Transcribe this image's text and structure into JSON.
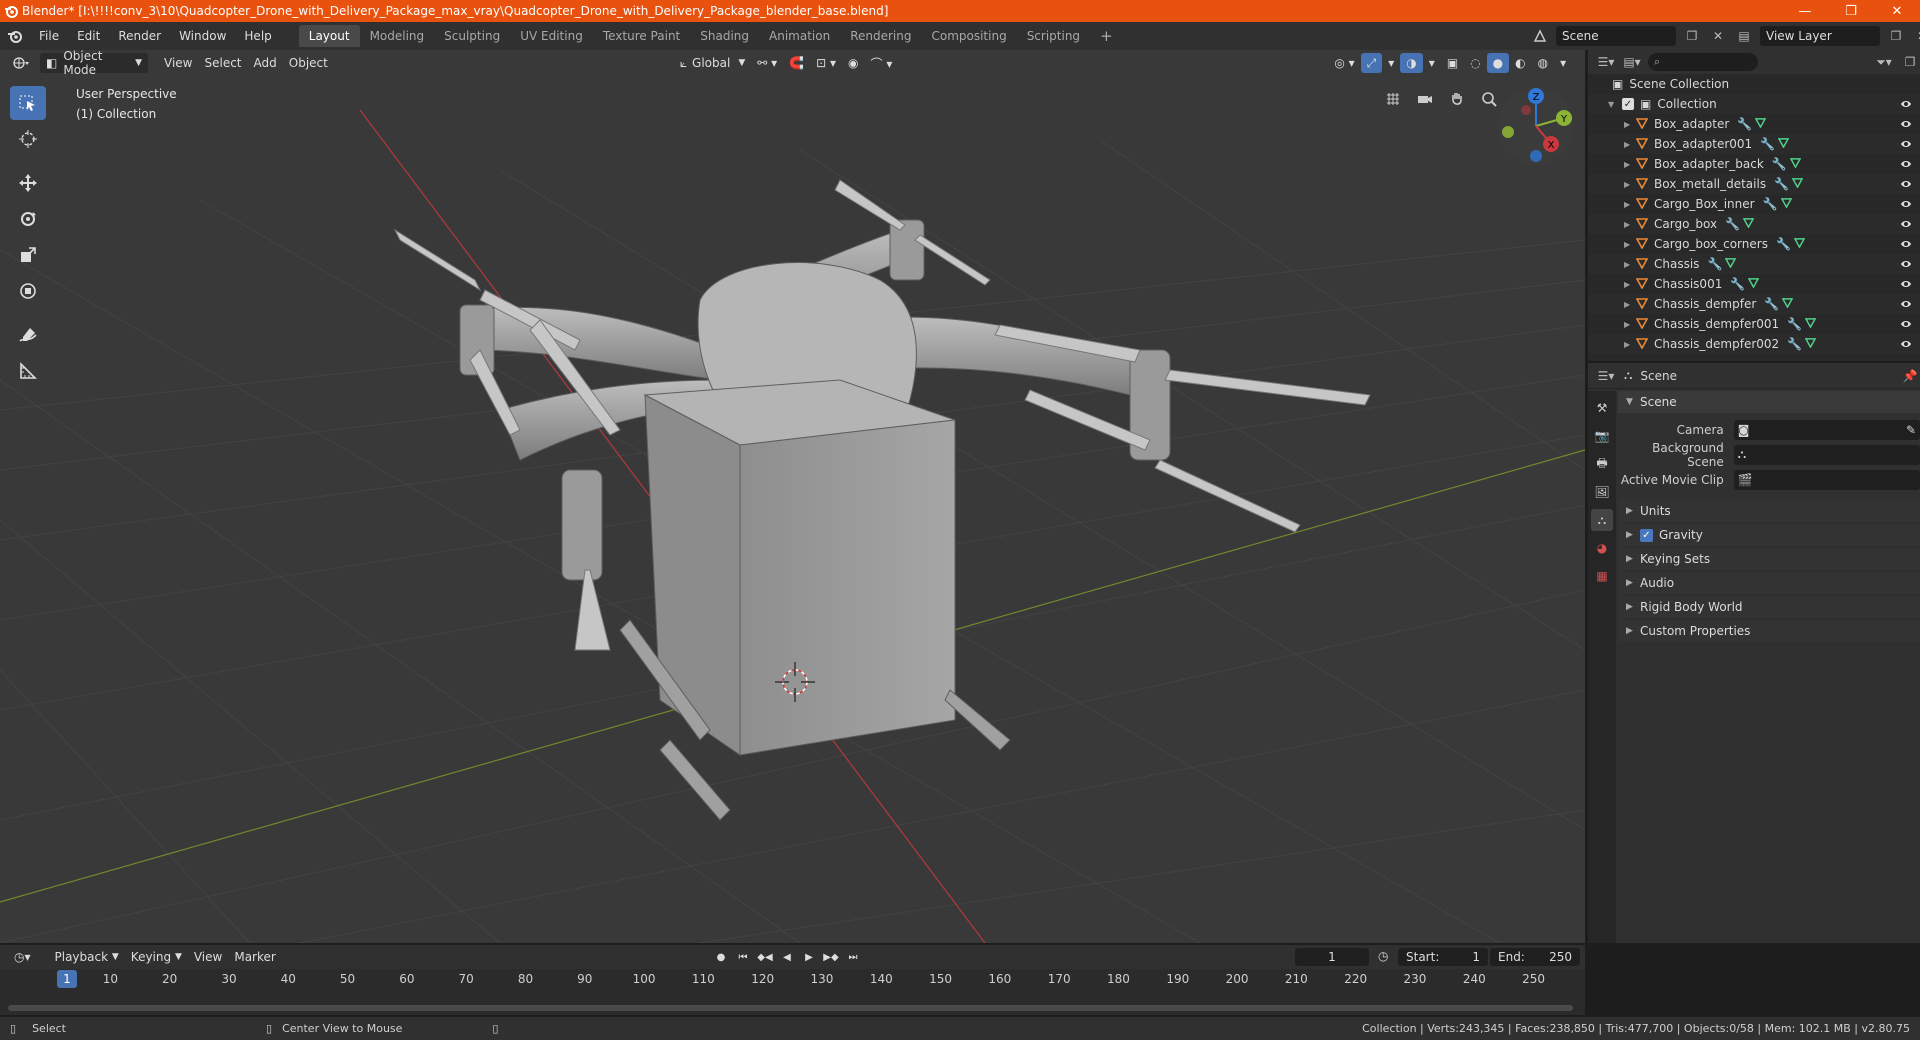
{
  "window": {
    "title": "Blender* [I:\\!!!!conv_3\\10\\Quadcopter_Drone_with_Delivery_Package_max_vray\\Quadcopter_Drone_with_Delivery_Package_blender_base.blend]",
    "controls": [
      "—",
      "❐",
      "✕"
    ]
  },
  "menu": [
    "File",
    "Edit",
    "Render",
    "Window",
    "Help"
  ],
  "workspaces": [
    "Layout",
    "Modeling",
    "Sculpting",
    "UV Editing",
    "Texture Paint",
    "Shading",
    "Animation",
    "Rendering",
    "Compositing",
    "Scripting"
  ],
  "active_workspace": "Layout",
  "scene_selector": "Scene",
  "view_layer": "View Layer",
  "viewport": {
    "mode": "Object Mode",
    "menus": [
      "View",
      "Select",
      "Add",
      "Object"
    ],
    "transform_orientation": "Global",
    "info_line1": "User Perspective",
    "info_line2": "(1) Collection",
    "gizmo_axes": {
      "z": "Z",
      "y": "Y",
      "x": "X"
    }
  },
  "outliner": {
    "root": "Scene Collection",
    "collection": "Collection",
    "items": [
      "Box_adapter",
      "Box_adapter001",
      "Box_adapter_back",
      "Box_metall_details",
      "Cargo_Box_inner",
      "Cargo_box",
      "Cargo_box_corners",
      "Chassis",
      "Chassis001",
      "Chassis_dempfer",
      "Chassis_dempfer001",
      "Chassis_dempfer002"
    ]
  },
  "properties": {
    "header": "Scene",
    "panel": "Scene",
    "fields": [
      {
        "label": "Camera"
      },
      {
        "label": "Background Scene"
      },
      {
        "label": "Active Movie Clip"
      }
    ],
    "subpanels": [
      "Units",
      "Gravity",
      "Keying Sets",
      "Audio",
      "Rigid Body World",
      "Custom Properties"
    ]
  },
  "timeline": {
    "menus": [
      "Playback",
      "Keying",
      "View",
      "Marker"
    ],
    "current_frame": "1",
    "start_label": "Start:",
    "start": "1",
    "end_label": "End:",
    "end": "250",
    "ruler": [
      "10",
      "20",
      "30",
      "40",
      "50",
      "60",
      "70",
      "80",
      "90",
      "100",
      "110",
      "120",
      "130",
      "140",
      "150",
      "160",
      "170",
      "180",
      "190",
      "200",
      "210",
      "220",
      "230",
      "240",
      "250"
    ]
  },
  "status": {
    "left1": "Select",
    "left2": "Center View to Mouse",
    "right": "Collection | Verts:243,345 | Faces:238,850 | Tris:477,700 | Objects:0/58 | Mem: 102.1 MB | v2.80.75"
  },
  "colors": {
    "title_bar": "#e8510e",
    "accent_blue": "#4772b3",
    "mesh_orange": "#e88a3a",
    "modifier_blue": "#6fa8e0",
    "mesh_data_green": "#4fd18a",
    "x_axis": "#c8383f",
    "y_axis": "#8db334",
    "z_axis": "#2f77d8"
  }
}
